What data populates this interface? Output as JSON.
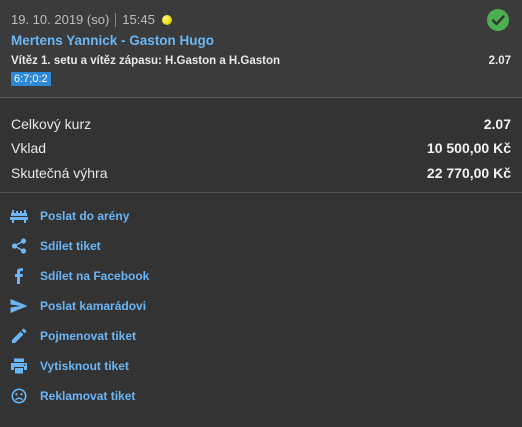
{
  "ticket": {
    "date": "19. 10. 2019 (so)",
    "time": "15:45",
    "sport_icon": "tennis-ball-icon",
    "status_icon": "check-circle-icon",
    "status_color": "#4caf50",
    "match": "Mertens Yannick - Gaston Hugo",
    "market": "Vítěz 1. setu a vítěz zápasu: H.Gaston a H.Gaston",
    "odd": "2.07",
    "score": "6:7;0:2"
  },
  "summary": {
    "total_odds_label": "Celkový kurz",
    "total_odds_value": "2.07",
    "stake_label": "Vklad",
    "stake_value": "10 500,00 Kč",
    "win_label": "Skutečná výhra",
    "win_value": "22 770,00 Kč"
  },
  "actions": [
    {
      "label": "Poslat do arény",
      "icon": "arena-icon"
    },
    {
      "label": "Sdílet tiket",
      "icon": "share-icon"
    },
    {
      "label": "Sdílet na Facebook",
      "icon": "facebook-icon"
    },
    {
      "label": "Poslat kamarádovi",
      "icon": "send-icon"
    },
    {
      "label": "Pojmenovat tiket",
      "icon": "pencil-icon"
    },
    {
      "label": "Vytisknout tiket",
      "icon": "printer-icon"
    },
    {
      "label": "Reklamovat tiket",
      "icon": "sad-face-icon"
    }
  ],
  "colors": {
    "accent": "#6cb6f5",
    "background": "#333333",
    "score_badge": "#2e88d8"
  }
}
